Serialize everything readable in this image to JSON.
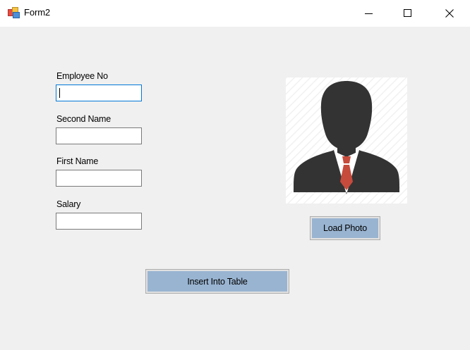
{
  "window": {
    "title": "Form2"
  },
  "fields": {
    "employee_no": {
      "label": "Employee No",
      "value": ""
    },
    "second_name": {
      "label": "Second Name",
      "value": ""
    },
    "first_name": {
      "label": "First Name",
      "value": ""
    },
    "salary": {
      "label": "Salary",
      "value": ""
    }
  },
  "buttons": {
    "load_photo": "Load Photo",
    "insert": "Insert Into Table"
  },
  "icons": {
    "app": "form-app-icon",
    "minimize": "minimize-icon",
    "maximize": "maximize-icon",
    "close": "close-icon",
    "avatar": "person-silhouette-placeholder"
  },
  "colors": {
    "button_fill": "#99b4d1",
    "focus_border": "#0078d7",
    "form_background": "#f0f0f0",
    "avatar_dark": "#333333",
    "tie": "#c64b3c"
  }
}
